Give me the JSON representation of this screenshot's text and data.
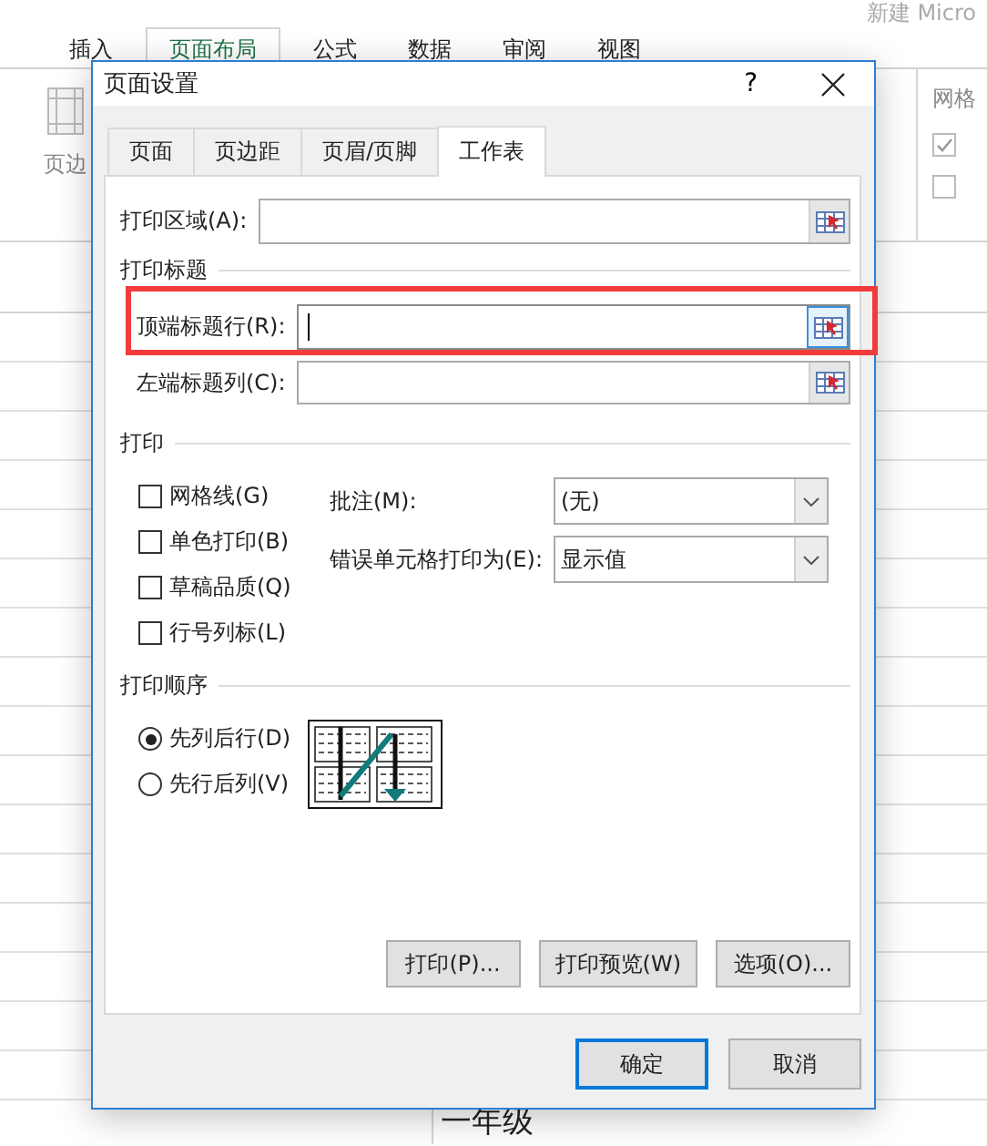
{
  "app": {
    "title": "新建 Micro",
    "ribbon_tabs": [
      {
        "label": "插入",
        "selected": false
      },
      {
        "label": "页面布局",
        "selected": true
      },
      {
        "label": "公式",
        "selected": false
      },
      {
        "label": "数据",
        "selected": false
      },
      {
        "label": "审阅",
        "selected": false
      },
      {
        "label": "视图",
        "selected": false
      }
    ],
    "ribbon": {
      "margins_label": "页边",
      "group_label": "网格",
      "checks": [
        {
          "checked": true
        },
        {
          "checked": false
        }
      ]
    },
    "sheet": {
      "cell": "一年级"
    }
  },
  "dialog": {
    "title": "页面设置",
    "help": "?",
    "tabs": [
      {
        "label": "页面",
        "selected": false
      },
      {
        "label": "页边距",
        "selected": false
      },
      {
        "label": "页眉/页脚",
        "selected": false
      },
      {
        "label": "工作表",
        "selected": true
      }
    ],
    "print_area": {
      "label": "打印区域(A):"
    },
    "print_titles": {
      "heading": "打印标题",
      "rows_label": "顶端标题行(R):",
      "rows_focused": true,
      "rows_highlighted": true,
      "cols_label": "左端标题列(C):"
    },
    "print": {
      "heading": "打印",
      "options": [
        {
          "label": "网格线(G)",
          "checked": false
        },
        {
          "label": "单色打印(B)",
          "checked": false
        },
        {
          "label": "草稿品质(Q)",
          "checked": false
        },
        {
          "label": "行号列标(L)",
          "checked": false
        }
      ],
      "selects": [
        {
          "label": "批注(M):",
          "value": "(无)"
        },
        {
          "label": "错误单元格打印为(E):",
          "value": "显示值"
        }
      ]
    },
    "page_order": {
      "heading": "打印顺序",
      "options": [
        {
          "label": "先列后行(D)",
          "selected": true
        },
        {
          "label": "先行后列(V)",
          "selected": false
        }
      ]
    },
    "action_buttons": [
      "打印(P)...",
      "打印预览(W)",
      "选项(O)..."
    ],
    "footer_buttons": [
      {
        "label": "确定",
        "default": true
      },
      {
        "label": "取消",
        "default": false
      }
    ]
  }
}
